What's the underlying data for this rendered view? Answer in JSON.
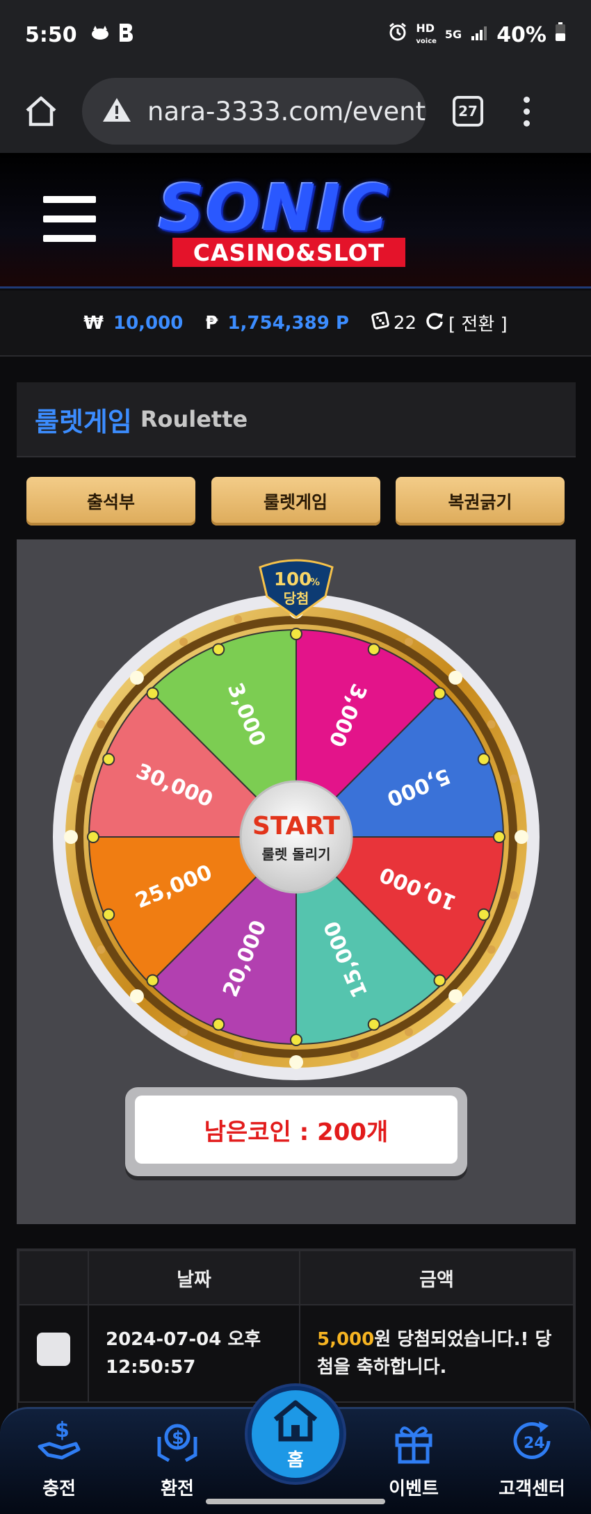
{
  "status_bar": {
    "time": "5:50",
    "indicators": [
      "cat-icon",
      "b-app-icon"
    ],
    "alarm_icon": "alarm-icon",
    "hd_label": "HD",
    "voice_label": "voice",
    "net_label": "5G",
    "battery": "40%"
  },
  "browser": {
    "url": "nara-3333.com/event_",
    "tab_count": "27"
  },
  "header": {
    "logo_word": "SONIC",
    "logo_sub": "CASINO&SLOT"
  },
  "balance": {
    "won_symbol": "₩",
    "won_value": "10,000",
    "point_symbol": "₱",
    "point_value": "1,754,389 P",
    "ticket_count": "22",
    "switch_label": "[ 전환 ]"
  },
  "section": {
    "title_ko": "룰렛게임",
    "title_en": "Roulette"
  },
  "tabs": [
    {
      "label": "출석부"
    },
    {
      "label": "룰렛게임"
    },
    {
      "label": "복권긁기"
    }
  ],
  "roulette": {
    "badge_top": "100",
    "badge_pct": "%",
    "badge_bottom": "당첨",
    "start_label": "START",
    "spin_label": "룰렛 돌리기",
    "segments": [
      {
        "label": "3,000",
        "color": "#e3148a"
      },
      {
        "label": "5,000",
        "color": "#3a72d8"
      },
      {
        "label": "10,000",
        "color": "#e8343a"
      },
      {
        "label": "15,000",
        "color": "#55c4ae"
      },
      {
        "label": "20,000",
        "color": "#b240b0"
      },
      {
        "label": "25,000",
        "color": "#f07d12"
      },
      {
        "label": "30,000",
        "color": "#ee6a72"
      },
      {
        "label": "3,000",
        "color": "#7ccd52"
      }
    ],
    "coins_label": "남은코인 : 200개"
  },
  "history": {
    "headers": [
      "",
      "날짜",
      "금액"
    ],
    "rows": [
      {
        "date": "2024-07-04 오후 12:50:57",
        "amount": "5,000",
        "message": "원 당첨되었습니다.! 당첨을 축하합니다."
      }
    ]
  },
  "bottom_nav": {
    "items": [
      {
        "label": "충전",
        "icon": "deposit-icon"
      },
      {
        "label": "환전",
        "icon": "exchange-icon"
      },
      {
        "label": "홈",
        "icon": "home-icon"
      },
      {
        "label": "이벤트",
        "icon": "gift-icon"
      },
      {
        "label": "고객센터",
        "icon": "support-24-icon"
      }
    ]
  }
}
